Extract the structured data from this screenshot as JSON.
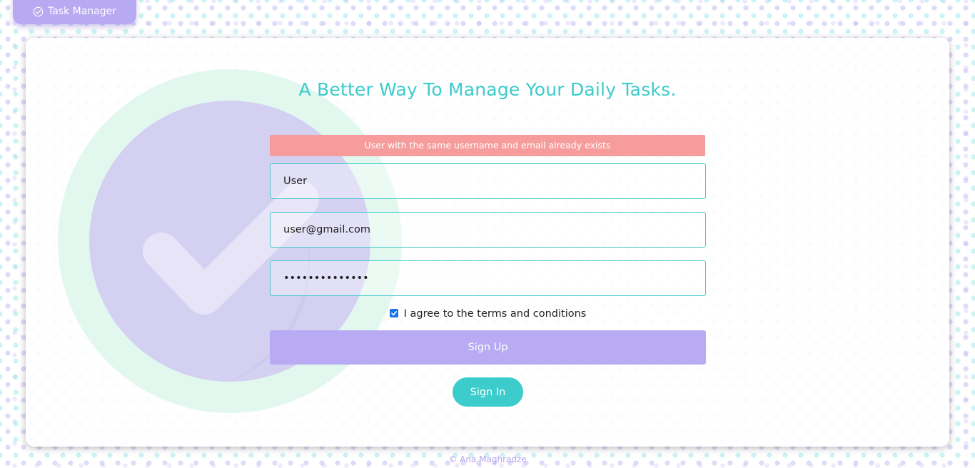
{
  "nav": {
    "brand_label": "Task Manager",
    "brand_icon": "check-circle-icon"
  },
  "main": {
    "title": "A Better Way To Manage Your Daily Tasks."
  },
  "form": {
    "error_message": "User with the same username and email already exists",
    "username_value": "User",
    "email_value": "user@gmail.com",
    "password_masked": "••••••••••••••",
    "terms_checked": true,
    "terms_label": "I agree to the terms and conditions",
    "submit_label": "Sign Up",
    "signin_label": "Sign In"
  },
  "footer": {
    "copyright": "© Ana Maghradze"
  },
  "colors": {
    "accent_teal": "#3ecbcb",
    "accent_purple": "#b8abf3",
    "error_red": "#f79c9c",
    "hero_outer": "#e2f8ef",
    "hero_inner": "#d3d0f1"
  }
}
